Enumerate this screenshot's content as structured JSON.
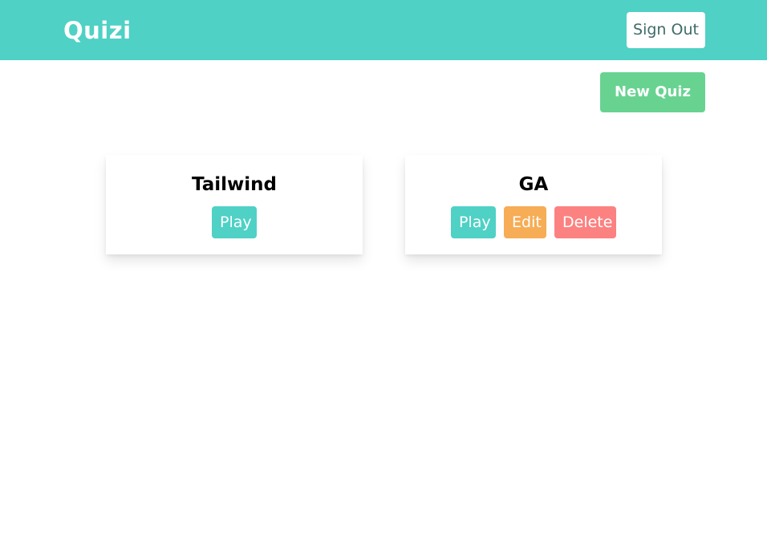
{
  "header": {
    "brand": "Quizi",
    "sign_out_label": "Sign Out"
  },
  "toolbar": {
    "new_quiz_label": "New Quiz"
  },
  "quizzes": [
    {
      "title": "Tailwind",
      "actions": {
        "play": "Play"
      }
    },
    {
      "title": "GA",
      "actions": {
        "play": "Play",
        "edit": "Edit",
        "delete": "Delete"
      }
    }
  ],
  "colors": {
    "nav": "#4fd1c5",
    "new_quiz": "#68d391",
    "play": "#4fd1c5",
    "edit": "#f6ad55",
    "delete": "#fc8181"
  }
}
